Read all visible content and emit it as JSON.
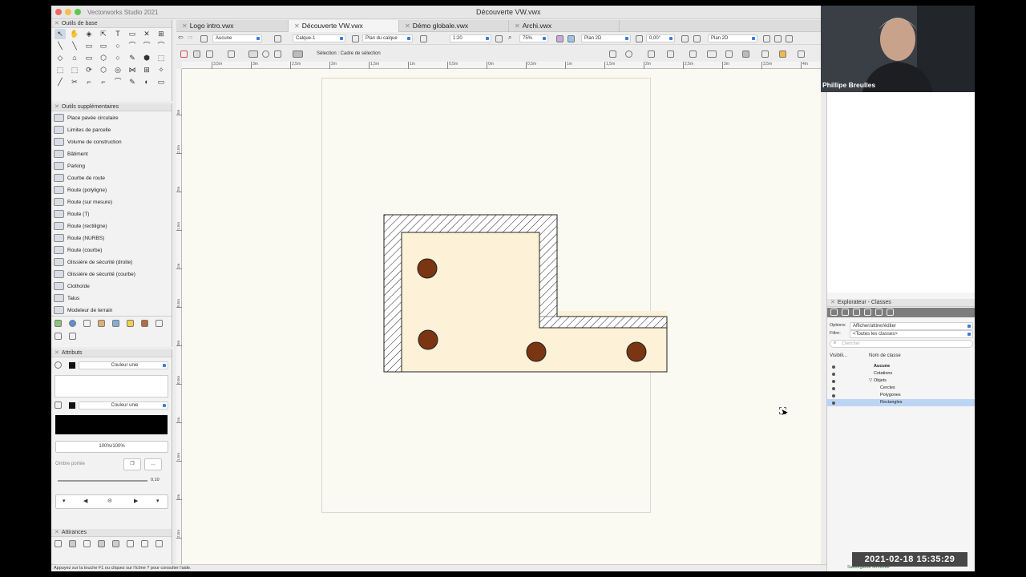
{
  "app": {
    "name": "Vectorworks Studio 2021",
    "document_title": "Découverte VW.vwx"
  },
  "tabs": [
    {
      "label": "Logo intro.vwx",
      "active": false
    },
    {
      "label": "Découverte VW.vwx",
      "active": true
    },
    {
      "label": "Démo globale.vwx",
      "active": false
    },
    {
      "label": "Archi.vwx",
      "active": false
    }
  ],
  "view_bar": {
    "class_select": "Aucune",
    "layer_select": "Calque-1",
    "view_plane": "Plan du calque",
    "scale": "1:20",
    "zoom": "75%",
    "view_mode": "Plan 2D",
    "rotation": "0,00°",
    "render_mode": "Plan 2D"
  },
  "mode_bar": {
    "selection_mode": "Sélection : Cadre de sélection"
  },
  "ruler": {
    "h_labels": [
      "3,5m",
      "3m",
      "2,5m",
      "2m",
      "1,5m",
      "1m",
      "0,5m",
      "0m",
      "0,5m",
      "1m",
      "1,5m",
      "2m",
      "2,5m",
      "3m",
      "3,5m",
      "4m"
    ],
    "v_labels": [
      "3m",
      "2,5m",
      "2m",
      "1,5m",
      "1m",
      "0,5m",
      "0m",
      "0,5m",
      "1m",
      "1,5m",
      "2m",
      "2,5m",
      "3m"
    ]
  },
  "panels": {
    "basic_tools": "Outils de base",
    "extra_tools": "Outils supplémentaires",
    "attributes": "Attributs",
    "snaps": "Attirances"
  },
  "extra_tools": [
    "Place pavée circulaire",
    "Limites de parcelle",
    "Volume de construction",
    "Bâtiment",
    "Parking",
    "Courbe de route",
    "Route (polyligne)",
    "Route (sur mesure)",
    "Route (T)",
    "Route (rectiligne)",
    "Route (NURBS)",
    "Route (courbe)",
    "Glissière de sécurité (droite)",
    "Glissière de sécurité (courbe)",
    "Clothoïde",
    "Talus",
    "Modeleur de terrain"
  ],
  "attributes": {
    "fill_type": "Couleur unie",
    "pen_type": "Couleur unie",
    "opacity": "100%/100%",
    "drop_shadow": "Ombre portée",
    "line_thickness": "0,10"
  },
  "class_explorer": {
    "title": "Explorateur - Classes",
    "options_label": "Options:",
    "options_value": "Afficher/attirer/éditer",
    "filter_label": "Filtre:",
    "filter_value": "<Toutes les classes>",
    "search_placeholder": "Chercher",
    "col_visibility": "Visibili...",
    "col_name": "Nom de classe",
    "rows": [
      {
        "name": "Aucune",
        "indent": 0,
        "bold": true,
        "selected": false
      },
      {
        "name": "Cotations",
        "indent": 0,
        "bold": false,
        "selected": false
      },
      {
        "name": "Objets",
        "indent": 0,
        "bold": false,
        "selected": false,
        "expander": "▽"
      },
      {
        "name": "Cercles",
        "indent": 1,
        "bold": false,
        "selected": false
      },
      {
        "name": "Polygones",
        "indent": 1,
        "bold": false,
        "selected": false
      },
      {
        "name": "Rectangles",
        "indent": 1,
        "bold": false,
        "selected": true
      }
    ]
  },
  "status": {
    "help": "Appuyez sur la touche F1 ou cliquez sur l'icône ? pour consulter l'aide.",
    "saved": "Sauvegarde terminée"
  },
  "video": {
    "participant": "Phillipe Breulles"
  },
  "timestamp": "2021-02-18  15:35:29",
  "colors": {
    "floor_fill": "#fdf1d8",
    "circle_fill": "#7a3512",
    "selection_blue": "#bcd5f5",
    "accent": "#3b7bd8"
  }
}
